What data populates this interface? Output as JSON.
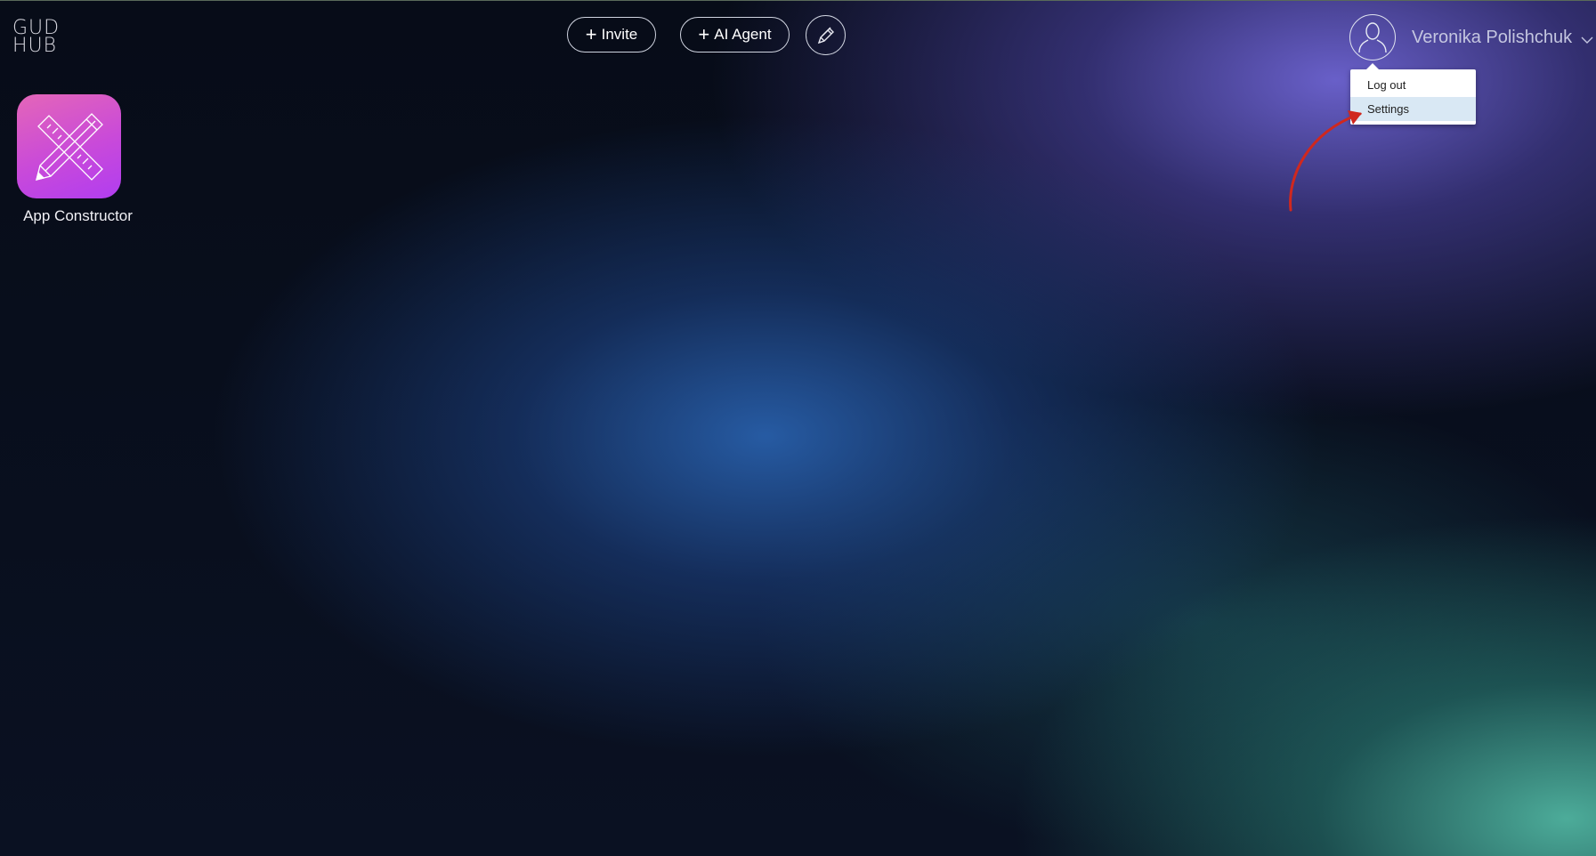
{
  "logo": {
    "line1": "GUD",
    "line2": "HUB"
  },
  "header": {
    "invite_label": "Invite",
    "ai_agent_label": "AI Agent",
    "edit_icon": "pencil-icon",
    "plus_icon": "plus-icon"
  },
  "user": {
    "name": "Veronika Polishchuk",
    "avatar_icon": "user-icon",
    "menu_icon": "chevron-down-icon"
  },
  "user_menu": {
    "items": [
      {
        "label": "Log out",
        "active": false
      },
      {
        "label": "Settings",
        "active": true
      }
    ]
  },
  "apps": [
    {
      "label": "App Constructor",
      "icon": "ruler-pencil-icon"
    }
  ],
  "annotation": {
    "color": "#d0281e"
  },
  "colors": {
    "app_icon_gradient_start": "#e466b8",
    "app_icon_gradient_end": "#b13df0",
    "menu_active_bg": "#d9e8f4"
  }
}
